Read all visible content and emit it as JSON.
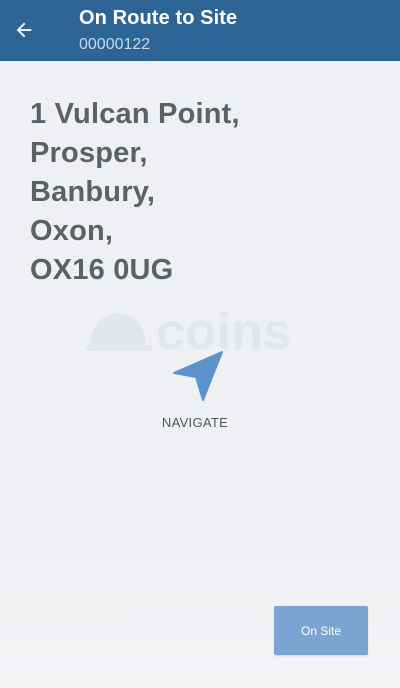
{
  "header": {
    "title": "On Route to Site",
    "subtitle": "00000122",
    "back_icon": "arrow-left-icon",
    "background_color": "#2d6496"
  },
  "address": {
    "lines": [
      "1 Vulcan Point,",
      "Prosper,",
      "Banbury,",
      "Oxon,",
      "OX16 0UG"
    ]
  },
  "watermark": {
    "text": "coins",
    "icon": "hard-hat-icon"
  },
  "navigate": {
    "icon": "navigation-arrow-icon",
    "label": "NAVIGATE",
    "icon_color": "#5c93cb"
  },
  "actions": {
    "on_site_label": "On Site",
    "on_site_color": "#7ba4d2"
  }
}
